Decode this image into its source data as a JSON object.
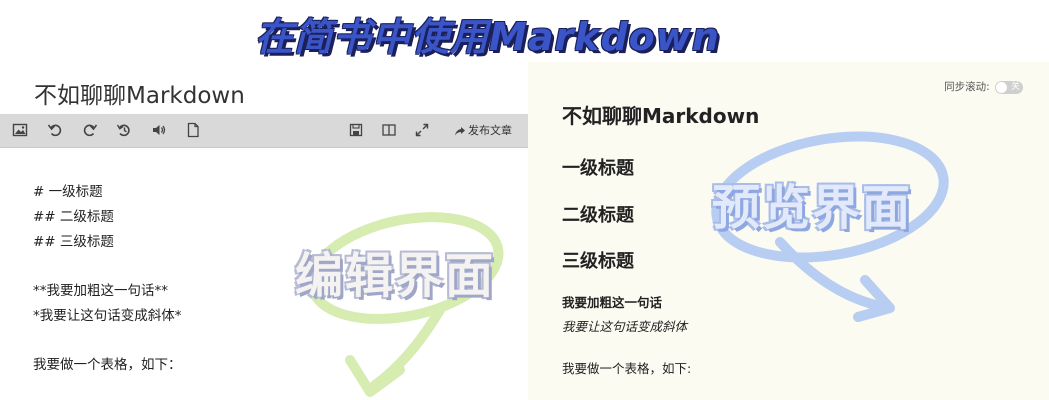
{
  "banner": {
    "title": "在简书中使用Markdown"
  },
  "editor": {
    "title": "不如聊聊Markdown",
    "toolbar": {
      "icons": [
        "image-icon",
        "undo-icon",
        "redo-icon",
        "history-icon",
        "audio-icon",
        "file-icon",
        "save-icon",
        "split-view-icon",
        "fullscreen-icon"
      ],
      "publish_label": "发布文章"
    },
    "lines": [
      "# 一级标题",
      "## 二级标题",
      "## 三级标题",
      "",
      "**我要加粗这一句话**",
      "*我要让这句话变成斜体*",
      "",
      "我要做一个表格，如下："
    ],
    "overlay_label": "编辑界面"
  },
  "preview": {
    "sync_label": "同步滚动:",
    "toggle_label": "关",
    "title": "不如聊聊Markdown",
    "headings": [
      "一级标题",
      "二级标题",
      "三级标题"
    ],
    "bold_text": "我要加粗这一句话",
    "italic_text": "我要让这句话变成斜体",
    "table_intro": "我要做一个表格，如下:",
    "overlay_label": "预览界面"
  },
  "colors": {
    "banner_fill": "#3a55c8",
    "toolbar_bg": "#d9d9d9",
    "preview_bg": "#fcfbf2",
    "deco_green": "#d7ecb0",
    "deco_blue": "#b8cdf2"
  }
}
